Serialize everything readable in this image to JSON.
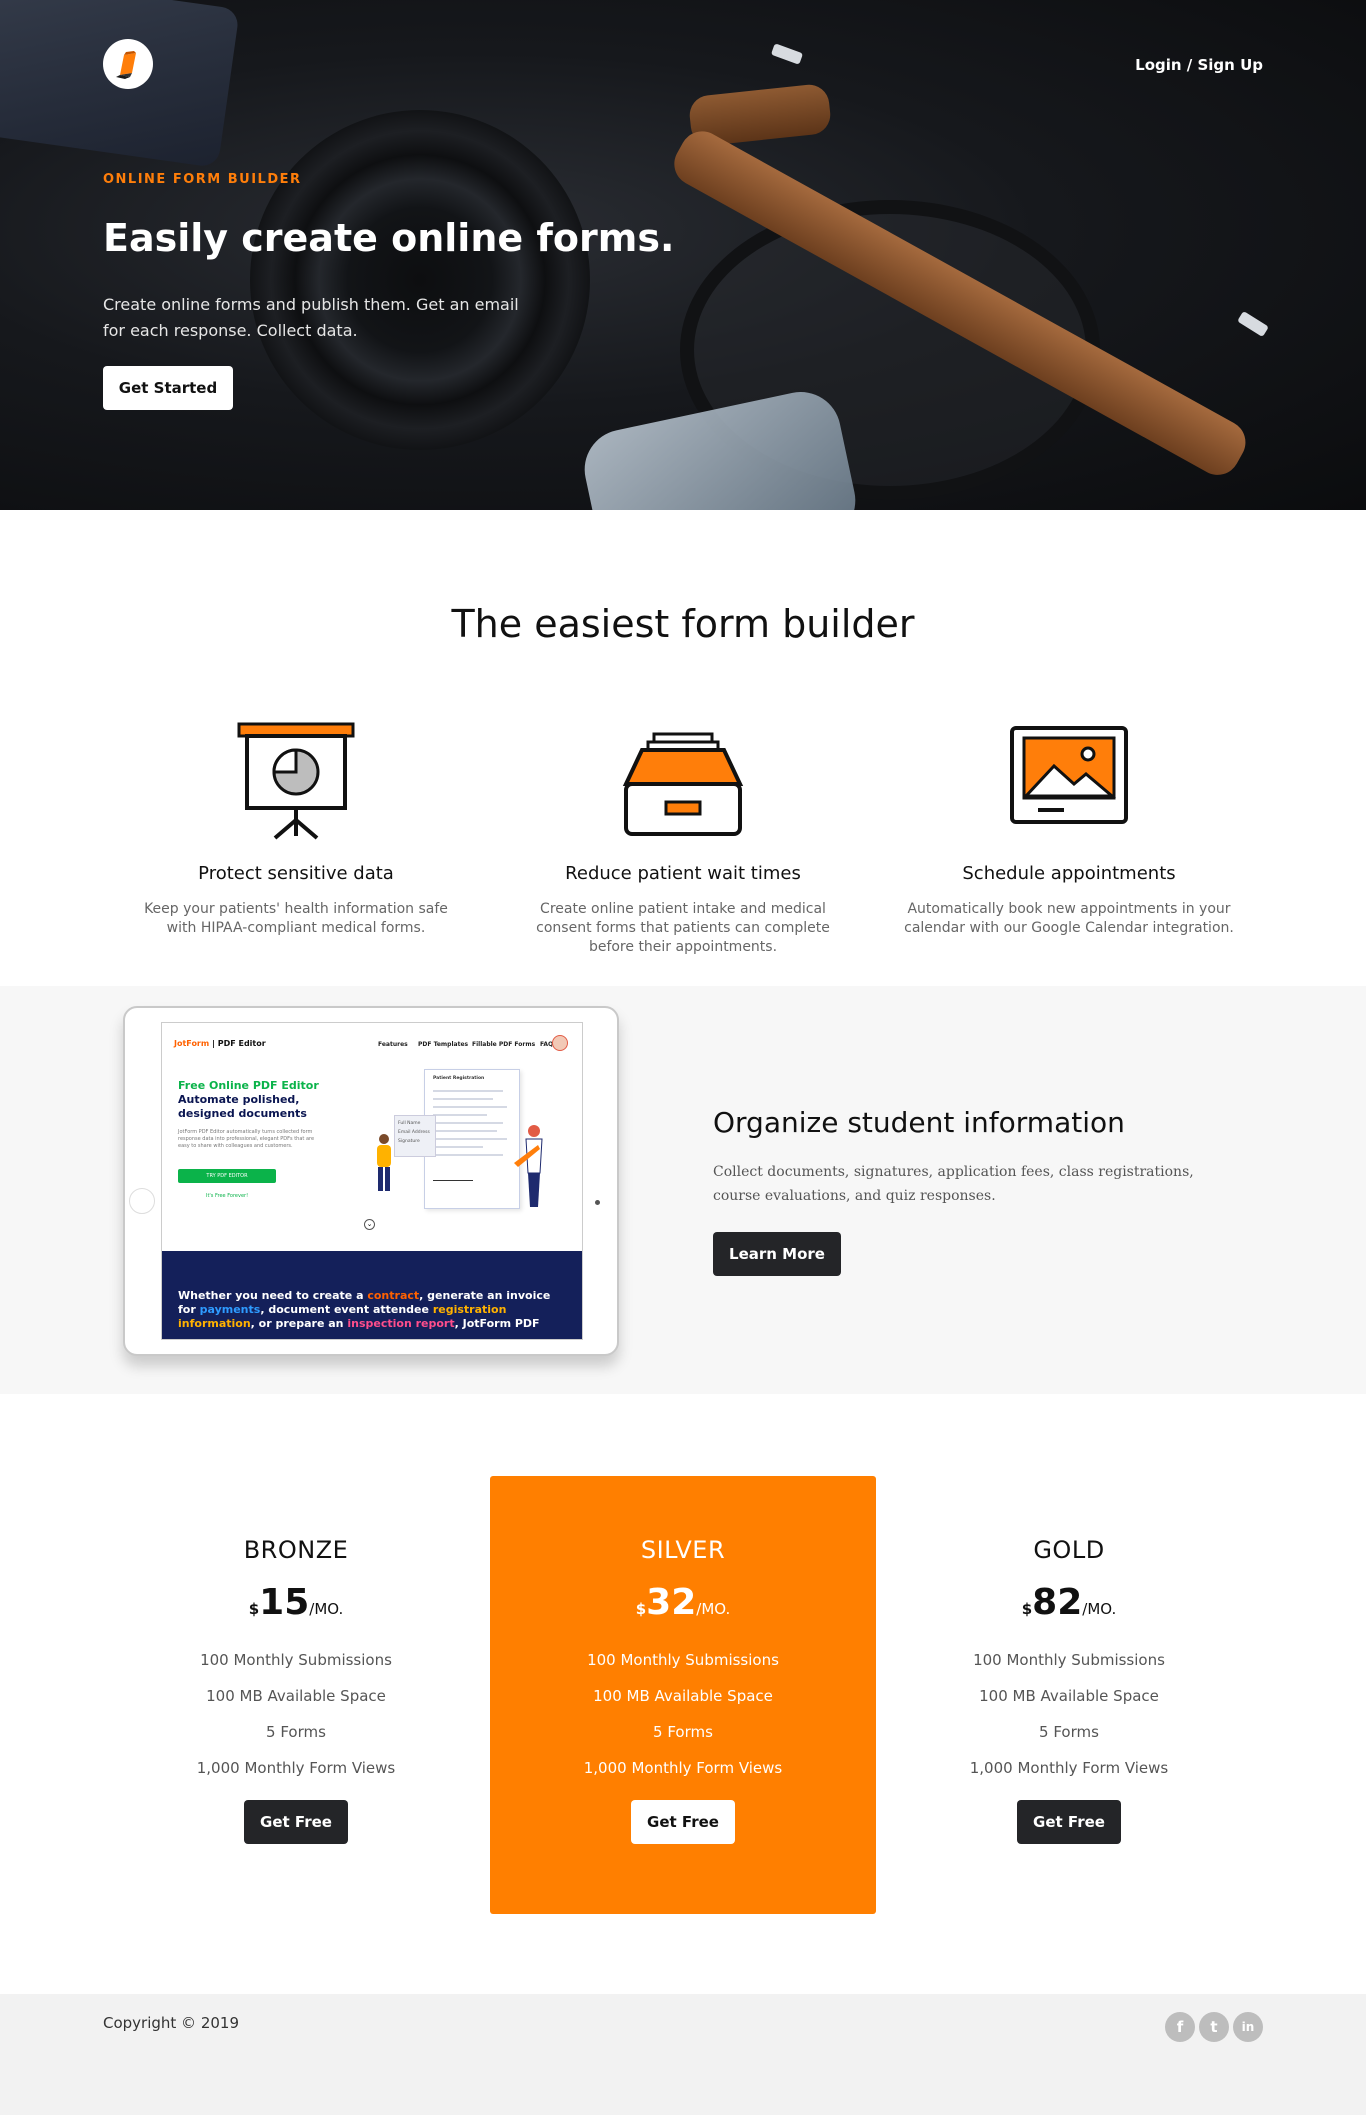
{
  "header": {
    "logo_icon": "pencil-logo-icon",
    "login_label": "Login / Sign Up"
  },
  "hero": {
    "eyebrow": "ONLINE FORM BUILDER",
    "title": "Easily create online forms.",
    "subtitle": "Create online forms and publish them. Get an email for each response. Collect data.",
    "cta_label": "Get Started"
  },
  "features": {
    "title": "The easiest form builder",
    "items": [
      {
        "icon": "presentation-chart-icon",
        "title": "Protect sensitive data",
        "text": "Keep your patients' health information safe with HIPAA-compliant medical forms."
      },
      {
        "icon": "inbox-tray-icon",
        "title": "Reduce patient wait times",
        "text": "Create online patient intake and medical consent forms that patients can complete before their appointments."
      },
      {
        "icon": "image-frame-icon",
        "title": "Schedule appointments",
        "text": "Automatically book new appointments in your calendar with our Google Calendar integration."
      }
    ]
  },
  "organize": {
    "title": "Organize student information",
    "text": "Collect documents, signatures, application fees, class registrations, course evaluations, and quiz responses.",
    "button_label": "Learn More",
    "tablet_screen": {
      "brand_a": "JotForm",
      "brand_b": "| PDF Editor",
      "nav": [
        "Features",
        "PDF Templates",
        "Fillable PDF Forms",
        "FAQ"
      ],
      "kicker": "Free Online PDF Editor",
      "headline": "Automate polished, designed documents",
      "body": "JotForm PDF Editor automatically turns collected form response data into professional, elegant PDFs that are easy to share with colleagues and customers.",
      "button": "TRY PDF EDITOR",
      "free_note": "It's Free Forever!",
      "doc_title": "Patient Registration",
      "fields": [
        "Full Name",
        "Email Address",
        "Signature"
      ],
      "band": {
        "p1": "Whether you need to create a ",
        "w1": "contract",
        "p2": ", generate an invoice for ",
        "w2": "payments",
        "p3": ", document event attendee ",
        "w3": "registration information",
        "p4": ", or prepare an ",
        "w4": "inspection report",
        "p5": ", JotForm PDF"
      }
    }
  },
  "pricing": {
    "plans": [
      {
        "name": "BRONZE",
        "currency": "$",
        "amount": "15",
        "period": "/MO.",
        "features": [
          "100 Monthly Submissions",
          "100 MB Available Space",
          "5 Forms",
          "1,000 Monthly Form Views"
        ],
        "button": "Get Free",
        "highlight": false
      },
      {
        "name": "SILVER",
        "currency": "$",
        "amount": "32",
        "period": "/MO.",
        "features": [
          "100 Monthly Submissions",
          "100 MB Available Space",
          "5 Forms",
          "1,000 Monthly Form Views"
        ],
        "button": "Get Free",
        "highlight": true
      },
      {
        "name": "GOLD",
        "currency": "$",
        "amount": "82",
        "period": "/MO.",
        "features": [
          "100 Monthly Submissions",
          "100 MB Available Space",
          "5 Forms",
          "1,000 Monthly Form Views"
        ],
        "button": "Get Free",
        "highlight": false
      }
    ],
    "highlight_color": "#ff7f00"
  },
  "footer": {
    "copyright": "Copyright © 2019",
    "social": [
      {
        "icon": "facebook-icon",
        "glyph": "f"
      },
      {
        "icon": "twitter-icon",
        "glyph": "t"
      },
      {
        "icon": "linkedin-icon",
        "glyph": "in"
      }
    ]
  },
  "colors": {
    "accent": "#ff7e0a",
    "dark_button": "#242528",
    "screen_band": "#14205a",
    "screen_green": "#0bb34a"
  }
}
